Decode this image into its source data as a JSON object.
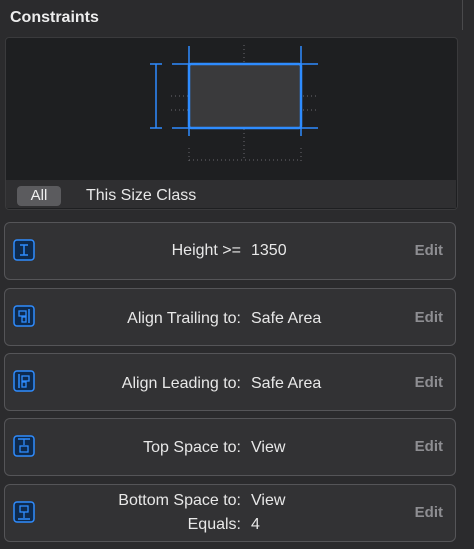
{
  "panel": {
    "title": "Constraints"
  },
  "size_class": {
    "all_label": "All",
    "this_size_label": "This Size Class"
  },
  "constraints": [
    {
      "name": "Height >=",
      "value": "1350",
      "edit": "Edit",
      "icon": "height-constraint-icon"
    },
    {
      "name": "Align Trailing to:",
      "value": "Safe Area",
      "edit": "Edit",
      "icon": "align-trailing-icon"
    },
    {
      "name": "Align Leading to:",
      "value": "Safe Area",
      "edit": "Edit",
      "icon": "align-leading-icon"
    },
    {
      "name": "Top Space to:",
      "value": "View",
      "edit": "Edit",
      "icon": "top-space-icon"
    },
    {
      "name": "Bottom Space to:",
      "value": "View",
      "name2": "Equals:",
      "value2": "4",
      "edit": "Edit",
      "icon": "bottom-space-icon"
    }
  ],
  "colors": {
    "accent": "#2f8cff",
    "background": "#2b2b2d",
    "card": "#323234"
  }
}
